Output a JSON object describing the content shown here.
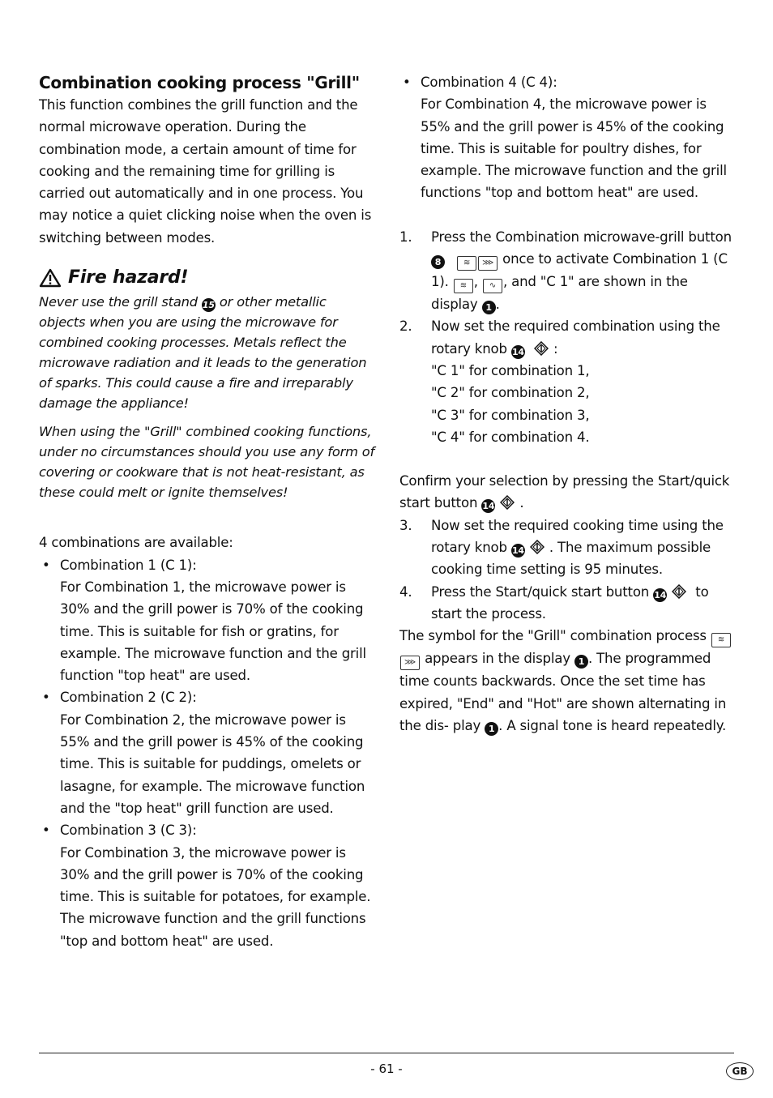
{
  "left": {
    "heading": "Combination cooking process \"Grill\"",
    "intro": "This function combines the grill function and the normal microwave operation. During the combination mode, a certain amount of time for cooking and the remaining time for grilling is carried out automatically and in one process. You may notice a quiet clicking noise when the oven is switching between modes.",
    "warning_title": "Fire hazard!",
    "warning_p1_a": "Never use the grill stand",
    "warning_p1_ref": "15",
    "warning_p1_b": "or other metallic objects when you are using the microwave for combined cooking processes. Metals reflect the microwave radiation and it leads to the generation of sparks. This could cause a fire and irreparably damage the appliance!",
    "warning_p2": "When using the \"Grill\" combined cooking functions, under no circumstances should you use any form of covering or cookware that is not heat-resistant, as these could melt or ignite themselves!",
    "combos_intro": "4 combinations are available:",
    "combos": [
      {
        "title": "Combination 1 (C 1):",
        "text": "For Combination 1, the microwave power is 30% and the grill power is 70% of the cooking time. This is suitable for fish or gratins, for example. The microwave function and the grill function \"top heat\" are used."
      },
      {
        "title": "Combination 2 (C 2):",
        "text": "For Combination 2, the microwave power is 55% and the grill power is 45% of the cooking time. This is suitable for puddings, omelets or lasagne, for example. The microwave function and the \"top heat\" grill function are used."
      },
      {
        "title": "Combination 3 (C 3):",
        "text": "For Combination 3, the microwave power is 30% and the grill power is 70% of the cooking time. This is suitable for potatoes, for example. The microwave function and the grill functions \"top and bottom heat\" are used."
      }
    ]
  },
  "right": {
    "combo4": {
      "title": "Combination 4 (C 4):",
      "text": "For Combination 4, the microwave power is 55% and the grill power is 45% of the cooking time. This is suitable for poultry dishes, for example. The microwave function and the grill functions \"top and bottom heat\" are used."
    },
    "step1": {
      "n": "1.",
      "a": "Press the Combination microwave-grill button",
      "ref": "8",
      "b": "once to activate Combination 1 (C 1).",
      "c": ", ",
      "d": ", and \"C 1\" are shown in the display",
      "ref2": "1",
      "e": "."
    },
    "step2": {
      "n": "2.",
      "a": "Now set the required combination using the rotary knob",
      "ref": "14",
      "b": ":",
      "lines": [
        "\"C 1\" for combination 1,",
        "\"C 2\" for combination 2,",
        "\"C 3\" for combination 3,",
        "\"C 4\" for combination 4."
      ]
    },
    "confirm_a": "Confirm your selection by pressing the Start/quick start button",
    "confirm_ref": "14",
    "confirm_b": ".",
    "step3": {
      "n": "3.",
      "a": "Now set the required cooking time using the rotary knob",
      "ref": "14",
      "b": ". The maximum possible cooking time setting is 95 minutes."
    },
    "step4": {
      "n": "4.",
      "a": "Press the Start/quick start button",
      "ref": "14",
      "b": "to start the process."
    },
    "final_a": "The symbol for the \"Grill\" combination process",
    "final_b": "appears in the display",
    "final_ref": "1",
    "final_c": ". The programmed time counts backwards. Once the set time has expired, \"End\" and \"Hot\" are shown alternating in the dis- play",
    "final_ref2": "1",
    "final_d": ". A signal tone is heard repeatedly."
  },
  "footer": {
    "page": "- 61 -",
    "lang": "GB"
  }
}
